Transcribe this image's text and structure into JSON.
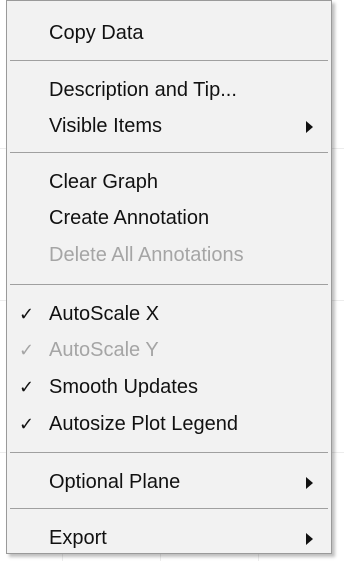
{
  "menu": {
    "copy_data": "Copy Data",
    "description_and_tip": "Description and Tip...",
    "visible_items": "Visible Items",
    "clear_graph": "Clear Graph",
    "create_annotation": "Create Annotation",
    "delete_all_annotations": "Delete All Annotations",
    "autoscale_x": "AutoScale X",
    "autoscale_y": "AutoScale Y",
    "smooth_updates": "Smooth Updates",
    "autosize_plot_legend": "Autosize Plot Legend",
    "optional_plane": "Optional Plane",
    "export": "Export",
    "check_glyph": "✓"
  }
}
